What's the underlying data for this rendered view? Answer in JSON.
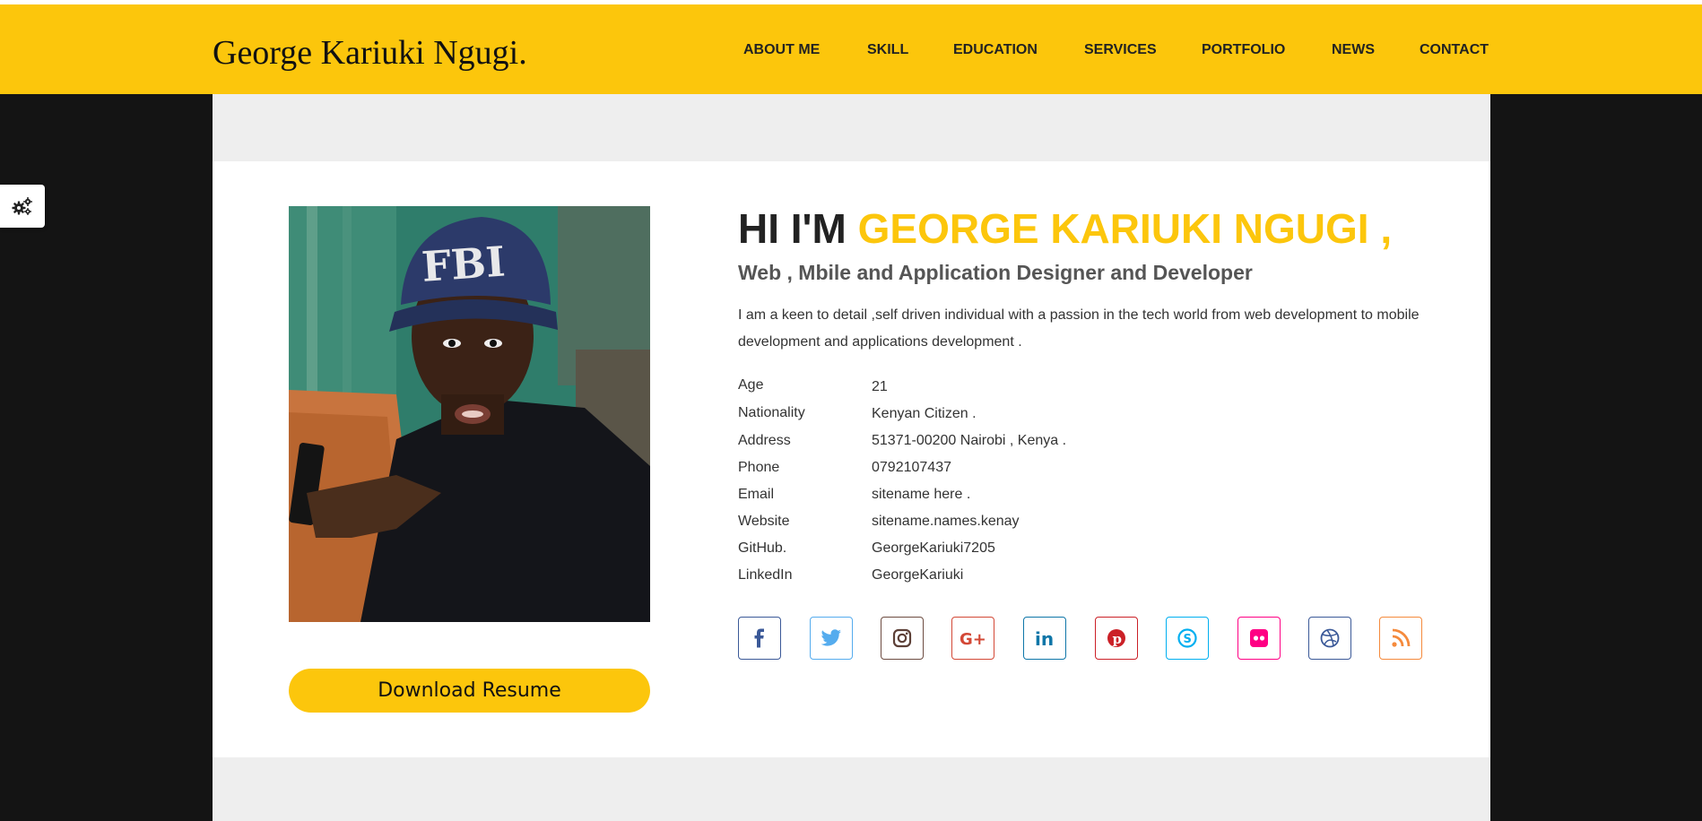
{
  "brand": {
    "name": "George Kariuki Ngugi."
  },
  "nav": {
    "items": [
      {
        "label": "ABOUT ME"
      },
      {
        "label": "SKILL"
      },
      {
        "label": "EDUCATION"
      },
      {
        "label": "SERVICES"
      },
      {
        "label": "PORTFOLIO"
      },
      {
        "label": "NEWS"
      },
      {
        "label": "CONTACT"
      }
    ]
  },
  "settings": {
    "icon": "gears-icon"
  },
  "hero": {
    "greeting": "HI I'M ",
    "name": "GEORGE KARIUKI NGUGI ,",
    "subtitle": "Web , Mbile and Application Designer and Developer",
    "bio": "I am a keen to detail ,self driven individual with a passion in the tech world from web development to mobile development and applications development ."
  },
  "info": [
    {
      "label": "Age",
      "value": "21"
    },
    {
      "label": "Nationality",
      "value": "Kenyan Citizen ."
    },
    {
      "label": "Address",
      "value": "51371-00200 Nairobi , Kenya ."
    },
    {
      "label": "Phone",
      "value": "0792107437"
    },
    {
      "label": "Email",
      "value": "sitename here ."
    },
    {
      "label": "Website",
      "value": "sitename.names.kenay"
    },
    {
      "label": "GitHub.",
      "value": "GeorgeKariuki7205"
    },
    {
      "label": "LinkedIn",
      "value": "GeorgeKariuki"
    }
  ],
  "download": {
    "label": "Download Resume"
  },
  "social": [
    {
      "icon": "facebook-icon",
      "color": "#3b5998"
    },
    {
      "icon": "twitter-icon",
      "color": "#55acee"
    },
    {
      "icon": "instagram-icon",
      "color": "#6d4c41"
    },
    {
      "icon": "google-plus-icon",
      "color": "#d34836"
    },
    {
      "icon": "linkedin-icon",
      "color": "#0e76a8"
    },
    {
      "icon": "pinterest-icon",
      "color": "#cb2027"
    },
    {
      "icon": "skype-icon",
      "color": "#00aff0"
    },
    {
      "icon": "flickr-icon",
      "color": "#ff0084"
    },
    {
      "icon": "dribbble-icon",
      "color": "#3b5998"
    },
    {
      "icon": "rss-icon",
      "color": "#f58a3c"
    }
  ],
  "colors": {
    "accent": "#fcc60c",
    "background": "#141414"
  }
}
